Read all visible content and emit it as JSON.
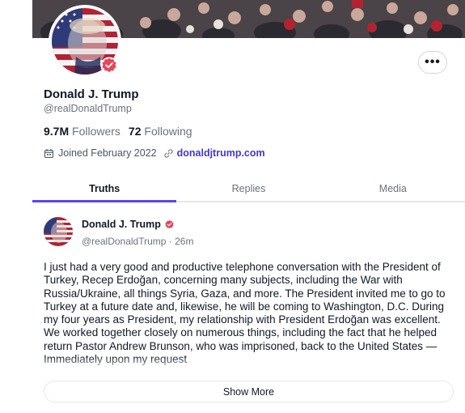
{
  "profile": {
    "name": "Donald J. Trump",
    "handle": "@realDonaldTrump",
    "followers_count": "9.7M",
    "followers_label": "Followers",
    "following_count": "72",
    "following_label": "Following",
    "joined": "Joined February 2022",
    "website": "donaldjtrump.com",
    "more_label": "•••"
  },
  "tabs": [
    {
      "label": "Truths",
      "active": true
    },
    {
      "label": "Replies",
      "active": false
    },
    {
      "label": "Media",
      "active": false
    }
  ],
  "post": {
    "author": "Donald J. Trump",
    "handle_time": "@realDonaldTrump · 26m",
    "body": "I just had a very good and productive telephone conversation with the President of Turkey, Recep Erdoğan, concerning many subjects, including the War with Russia/Ukraine, all things Syria, Gaza, and more. The President invited me to go to Turkey at a future date and, likewise, he will be coming to Washington, D.C. During my four years as President, my relationship with President Erdoğan was excellent. We worked together closely on numerous things, including the fact that he helped return Pastor Andrew Brunson, who was imprisoned, back to the United States — Immediately upon my request",
    "show_more_label": "Show More"
  },
  "colors": {
    "accent": "#5448ee",
    "verified": "#e5475b",
    "link": "#4338ca"
  },
  "icons": {
    "calendar": "calendar-icon",
    "link": "link-icon",
    "verified": "verified-badge-icon",
    "more": "more-options-icon"
  }
}
